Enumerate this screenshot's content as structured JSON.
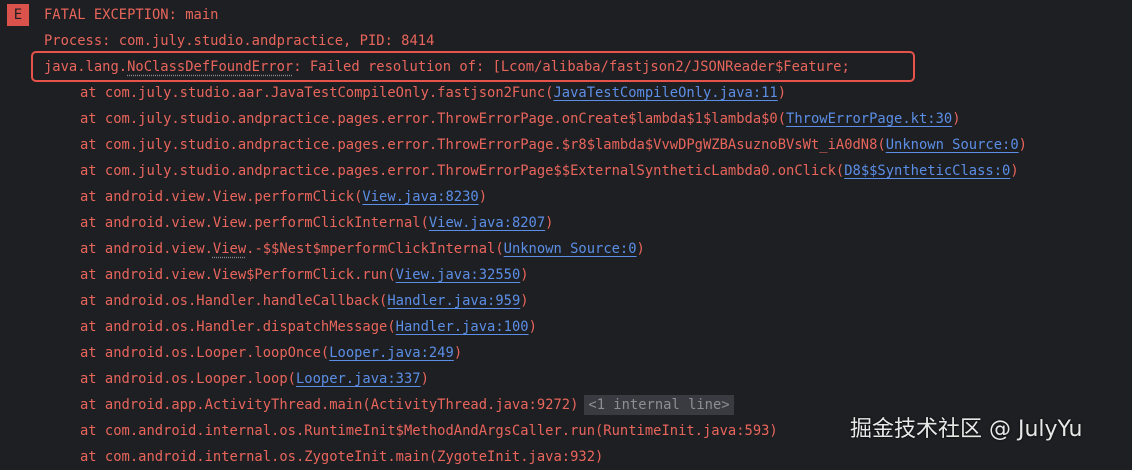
{
  "badge": "E",
  "lines": [
    {
      "type": "head",
      "parts": [
        {
          "t": "FATAL EXCEPTION: main"
        }
      ]
    },
    {
      "type": "head",
      "parts": [
        {
          "t": "Process: com.july.studio.andpractice, PID: 8414"
        }
      ]
    },
    {
      "type": "head",
      "highlight": true,
      "parts": [
        {
          "t": "java.lang."
        },
        {
          "t": "NoClassDefFoundError",
          "dotted": true
        },
        {
          "t": ": Failed resolution of: [Lcom/alibaba/fastjson2/JSONReader$Feature;"
        }
      ]
    },
    {
      "type": "at",
      "parts": [
        {
          "t": "at com.july.studio.aar.JavaTestCompileOnly.fastjson2Func("
        },
        {
          "t": "JavaTestCompileOnly.java:11",
          "link": true
        },
        {
          "t": ")"
        }
      ]
    },
    {
      "type": "at",
      "parts": [
        {
          "t": "at com.july.studio.andpractice.pages.error.ThrowErrorPage.onCreate$lambda$1$lambda$0("
        },
        {
          "t": "ThrowErrorPage.kt:30",
          "link": true
        },
        {
          "t": ")"
        }
      ]
    },
    {
      "type": "at",
      "parts": [
        {
          "t": "at com.july.studio.andpractice.pages.error.ThrowErrorPage.$r8$lambda$VvwDPgWZBAsuznoBVsWt_iA0dN8("
        },
        {
          "t": "Unknown Source:0",
          "link": true
        },
        {
          "t": ")"
        }
      ]
    },
    {
      "type": "at",
      "parts": [
        {
          "t": "at com.july.studio.andpractice.pages.error.ThrowErrorPage$$ExternalSyntheticLambda0.onClick("
        },
        {
          "t": "D8$$SyntheticClass:0",
          "link": true
        },
        {
          "t": ")"
        }
      ]
    },
    {
      "type": "at",
      "parts": [
        {
          "t": "at android.view.View.performClick("
        },
        {
          "t": "View.java:8230",
          "link": true
        },
        {
          "t": ")"
        }
      ]
    },
    {
      "type": "at",
      "parts": [
        {
          "t": "at android.view.View.performClickInternal("
        },
        {
          "t": "View.java:8207",
          "link": true
        },
        {
          "t": ")"
        }
      ]
    },
    {
      "type": "at",
      "parts": [
        {
          "t": "at android.view."
        },
        {
          "t": "View",
          "dotted": true
        },
        {
          "t": ".-$$Nest$mperformClickInternal("
        },
        {
          "t": "Unknown Source:0",
          "link": true
        },
        {
          "t": ")"
        }
      ]
    },
    {
      "type": "at",
      "parts": [
        {
          "t": "at android.view.View$PerformClick.run("
        },
        {
          "t": "View.java:32550",
          "link": true
        },
        {
          "t": ")"
        }
      ]
    },
    {
      "type": "at",
      "parts": [
        {
          "t": "at android.os.Handler.handleCallback("
        },
        {
          "t": "Handler.java:959",
          "link": true
        },
        {
          "t": ")"
        }
      ]
    },
    {
      "type": "at",
      "parts": [
        {
          "t": "at android.os.Handler.dispatchMessage("
        },
        {
          "t": "Handler.java:100",
          "link": true
        },
        {
          "t": ")"
        }
      ]
    },
    {
      "type": "at",
      "parts": [
        {
          "t": "at android.os.Looper.loopOnce("
        },
        {
          "t": "Looper.java:249",
          "link": true
        },
        {
          "t": ")"
        }
      ]
    },
    {
      "type": "at",
      "parts": [
        {
          "t": "at android.os.Looper.loop("
        },
        {
          "t": "Looper.java:337",
          "link": true
        },
        {
          "t": ")"
        }
      ]
    },
    {
      "type": "at",
      "parts": [
        {
          "t": "at android.app.ActivityThread.main(ActivityThread.java:9272)"
        },
        {
          "t": "<1 internal line>",
          "hint": true
        }
      ]
    },
    {
      "type": "at",
      "parts": [
        {
          "t": "at com.android.internal.os.RuntimeInit$MethodAndArgsCaller.run(RuntimeInit.java:593)"
        }
      ]
    },
    {
      "type": "at",
      "parts": [
        {
          "t": "at com.android.internal.os.ZygoteInit.main(ZygoteInit.java:932)"
        }
      ]
    }
  ],
  "watermark": "掘金技术社区 @ JulyYu"
}
